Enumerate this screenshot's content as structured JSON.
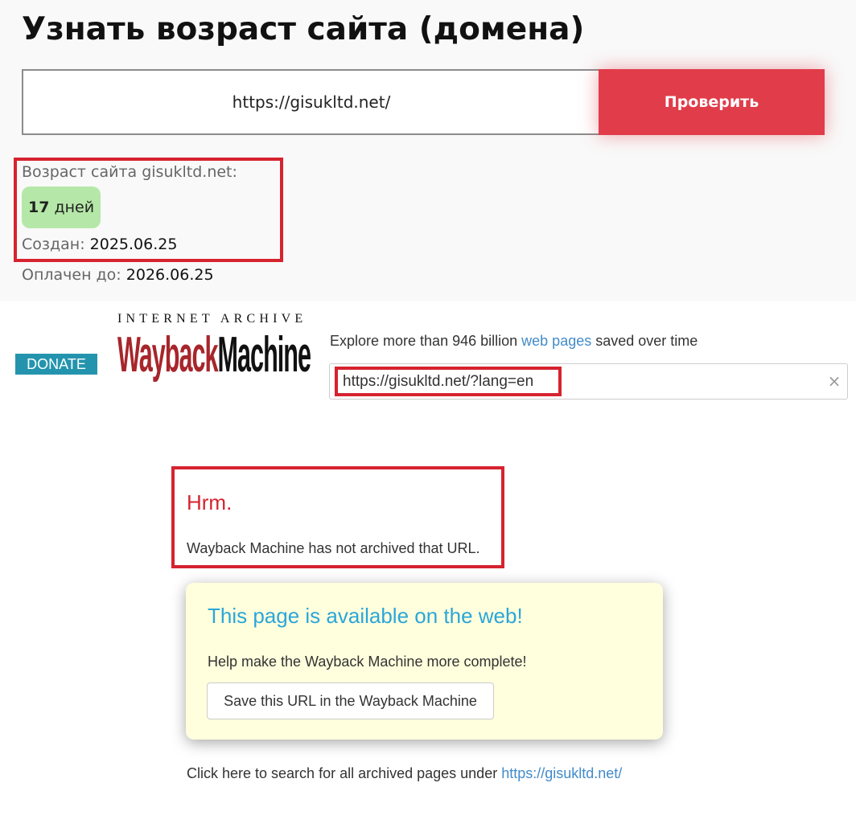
{
  "checker": {
    "title": "Узнать возраст сайта (домена)",
    "input_value": "https://gisukltd.net/",
    "button_label": "Проверить",
    "age_label": "Возраст сайта gisukltd.net:",
    "age_number": "17",
    "age_unit": "дней",
    "created_label": "Создан:",
    "created_value": "2025.06.25",
    "paid_label": "Оплачен до:",
    "paid_value": "2026.06.25",
    "badge_color": "#b5e8a8",
    "accent_color": "#e03c4a"
  },
  "wayback": {
    "donate_label": "DONATE",
    "logo_top": "INTERNET ARCHIVE",
    "logo_word": "WaybackMachine",
    "explore_prefix": "Explore more than 946 billion",
    "explore_link": "web pages",
    "explore_suffix": "saved over time",
    "search_value": "https://gisukltd.net/?lang=en",
    "clear_icon": "×",
    "hrm_title": "Hrm.",
    "hrm_text": "Wayback Machine has not archived that URL.",
    "available_title": "This page is available on the web!",
    "available_text": "Help make the Wayback Machine more complete!",
    "save_button_label": "Save this URL in the Wayback Machine",
    "bottom_prefix": "Click here to search for all archived pages under",
    "bottom_link": "https://gisukltd.net/",
    "link_color": "#428bca",
    "highlight_color": "#d6232f"
  }
}
